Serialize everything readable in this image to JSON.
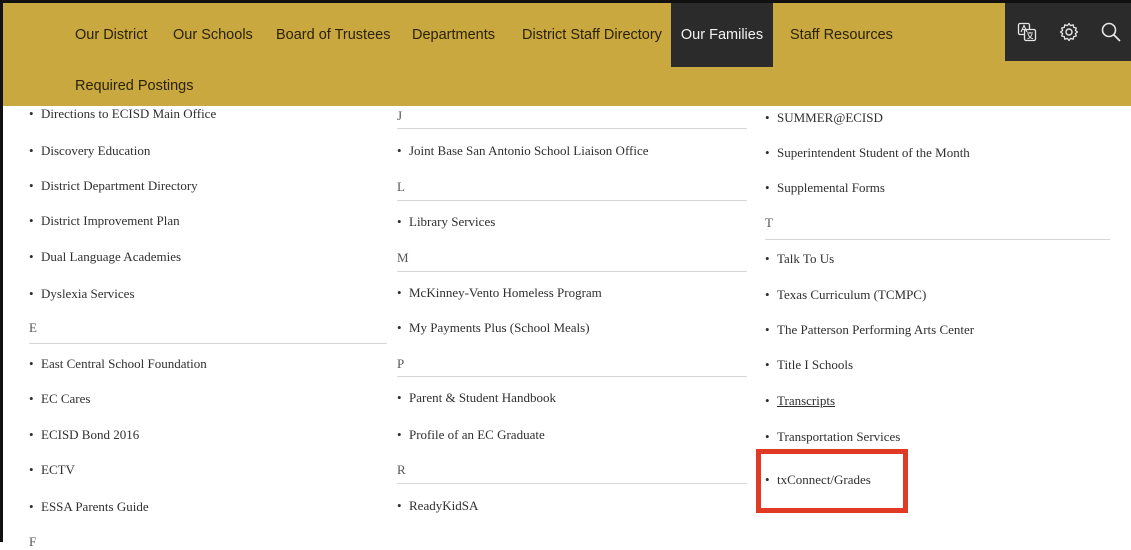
{
  "nav": {
    "items": [
      "Our District",
      "Our Schools",
      "Board of Trustees",
      "Departments",
      "District Staff Directory",
      "Our Families",
      "Staff Resources"
    ],
    "row2": "Required Postings",
    "active": "Our Families"
  },
  "tools": [
    "translate-icon",
    "gear-icon",
    "search-icon"
  ],
  "col1": {
    "items": [
      "Directions to ECISD Main Office",
      "Discovery Education",
      "District Department Directory",
      "District Improvement Plan",
      "Dual Language Academies",
      "Dyslexia Services"
    ],
    "letter_e": "E",
    "items_e": [
      "East Central School Foundation",
      "EC Cares",
      "ECISD Bond 2016",
      "ECTV",
      "ESSA Parents Guide"
    ],
    "letter_f": "F"
  },
  "col2": {
    "letter_j": "J",
    "items_j": [
      "Joint Base San Antonio School Liaison Office"
    ],
    "letter_l": "L",
    "items_l": [
      "Library Services"
    ],
    "letter_m": "M",
    "items_m": [
      "McKinney-Vento Homeless Program",
      "My Payments Plus (School Meals)"
    ],
    "letter_p": "P",
    "items_p": [
      "Parent & Student Handbook",
      "Profile of an EC Graduate"
    ],
    "letter_r": "R",
    "items_r": [
      "ReadyKidSA"
    ]
  },
  "col3": {
    "items_s": [
      "SUMMER@ECISD",
      "Superintendent Student of the Month",
      "Supplemental Forms"
    ],
    "letter_t": "T",
    "items_t": [
      "Talk To Us",
      "Texas Curriculum (TCMPC)",
      "The Patterson Performing Arts Center",
      "Title I Schools",
      "Transcripts",
      "Transportation Services",
      "txConnect/Grades"
    ]
  },
  "bullet": "•",
  "colors": {
    "nav_bg": "#c9a83f",
    "active_bg": "#2b2b2b",
    "highlight": "#e03a24"
  }
}
